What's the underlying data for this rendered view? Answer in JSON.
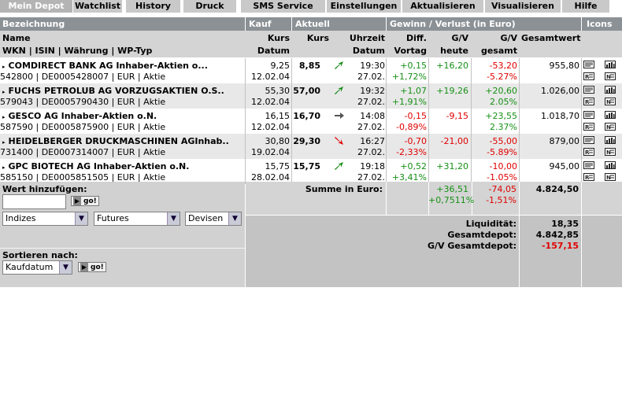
{
  "tabs": [
    {
      "label": "Mein Depot",
      "active": true
    },
    {
      "label": "Watchlist"
    },
    {
      "label": "History"
    },
    {
      "label": "Druck"
    },
    {
      "label": "SMS Service"
    },
    {
      "label": "Einstellungen"
    },
    {
      "label": "Aktualisieren"
    },
    {
      "label": "Visualisieren"
    },
    {
      "label": "Hilfe"
    }
  ],
  "header": {
    "bezeichnung": "Bezeichnung",
    "kauf": "Kauf",
    "aktuell": "Aktuell",
    "gewinn": "Gewinn / Verlust  (in Euro)",
    "icons": "Icons"
  },
  "columns": {
    "name": "Name",
    "wkn": "WKN | ISIN | Währung | WP-Typ",
    "kurs1": "Kurs",
    "datum1": "Datum",
    "kurs2": "Kurs",
    "uhrzeit": "Uhrzeit",
    "datum2": "Datum",
    "diff1": "Diff.",
    "diff2": "Vortag",
    "gvh1": "G/V",
    "gvh2": "heute",
    "gvg1": "G/V",
    "gvg2": "gesamt",
    "gesamtwert": "Gesamtwert"
  },
  "rows": [
    {
      "name": "COMDIRECT BANK AG Inhaber-Aktien o...",
      "info": "542800 | DE0005428007 | EUR | Aktie",
      "kauf_kurs": "9,25",
      "kauf_datum": "12.02.04",
      "kurs": "8,85",
      "arrow": "up",
      "zeit": "19:30",
      "datum": "27.02.",
      "diff": "+0,15",
      "diff_pct": "+1,72%",
      "gv_heute": "+16,20",
      "gv_gesamt": "-53,20",
      "gv_gesamt_pct": "-5.27%",
      "gesamtwert": "955,80"
    },
    {
      "name": "FUCHS PETROLUB AG VORZUGSAKTIEN O.S..",
      "info": "579043 | DE0005790430 | EUR | Aktie",
      "kauf_kurs": "55,30",
      "kauf_datum": "12.02.04",
      "kurs": "57,00",
      "arrow": "up",
      "zeit": "19:32",
      "datum": "27.02.",
      "diff": "+1,07",
      "diff_pct": "+1,91%",
      "gv_heute": "+19,26",
      "gv_gesamt": "+20,60",
      "gv_gesamt_pct": "2.05%",
      "gesamtwert": "1.026,00"
    },
    {
      "name": "GESCO AG Inhaber-Aktien o.N.",
      "info": "587590 | DE0005875900 | EUR | Aktie",
      "kauf_kurs": "16,15",
      "kauf_datum": "12.02.04",
      "kurs": "16,70",
      "arrow": "right",
      "zeit": "14:08",
      "datum": "27.02.",
      "diff": "-0,15",
      "diff_pct": "-0,89%",
      "gv_heute": "-9,15",
      "gv_gesamt": "+23,55",
      "gv_gesamt_pct": "2.37%",
      "gesamtwert": "1.018,70"
    },
    {
      "name": "HEIDELBERGER DRUCKMASCHINEN AGInhab..",
      "info": "731400 | DE0007314007 | EUR | Aktie",
      "kauf_kurs": "30,80",
      "kauf_datum": "19.02.04",
      "kurs": "29,30",
      "arrow": "down",
      "zeit": "16:27",
      "datum": "27.02.",
      "diff": "-0,70",
      "diff_pct": "-2,33%",
      "gv_heute": "-21,00",
      "gv_gesamt": "-55,00",
      "gv_gesamt_pct": "-5.89%",
      "gesamtwert": "879,00"
    },
    {
      "name": "GPC BIOTECH AG Inhaber-Aktien o.N.",
      "info": "585150 | DE0005851505 | EUR | Aktie",
      "kauf_kurs": "15,75",
      "kauf_datum": "28.02.04",
      "kurs": "15,75",
      "arrow": "up",
      "zeit": "19:18",
      "datum": "27.02.",
      "diff": "+0,52",
      "diff_pct": "+3,41%",
      "gv_heute": "+31,20",
      "gv_gesamt": "-10,00",
      "gv_gesamt_pct": "-1.05%",
      "gesamtwert": "945,00"
    }
  ],
  "summary": {
    "label": "Summe in Euro:",
    "gv_heute": "+36,51",
    "gv_heute_pct": "+0,7511%",
    "gv_gesamt": "-74,05",
    "gv_gesamt_pct": "-1,51%",
    "gesamtwert": "4.824,50",
    "liquiditaet_label": "Liquidität:",
    "liquiditaet": "18,35",
    "gesamtdepot_label": "Gesamtdepot:",
    "gesamtdepot": "4.842,85",
    "gv_depot_label": "G/V Gesamtdepot:",
    "gv_depot": "-157,15"
  },
  "controls": {
    "add_label": "Wert hinzufügen:",
    "add_value": "",
    "go": "go!",
    "select1": "Indizes",
    "select2": "Futures",
    "select3": "Devisen",
    "sort_label": "Sortieren nach:",
    "sort_value": "Kaufdatum"
  },
  "colors": {
    "green": "#159015",
    "red": "#e00000",
    "header": "#8c9195"
  }
}
